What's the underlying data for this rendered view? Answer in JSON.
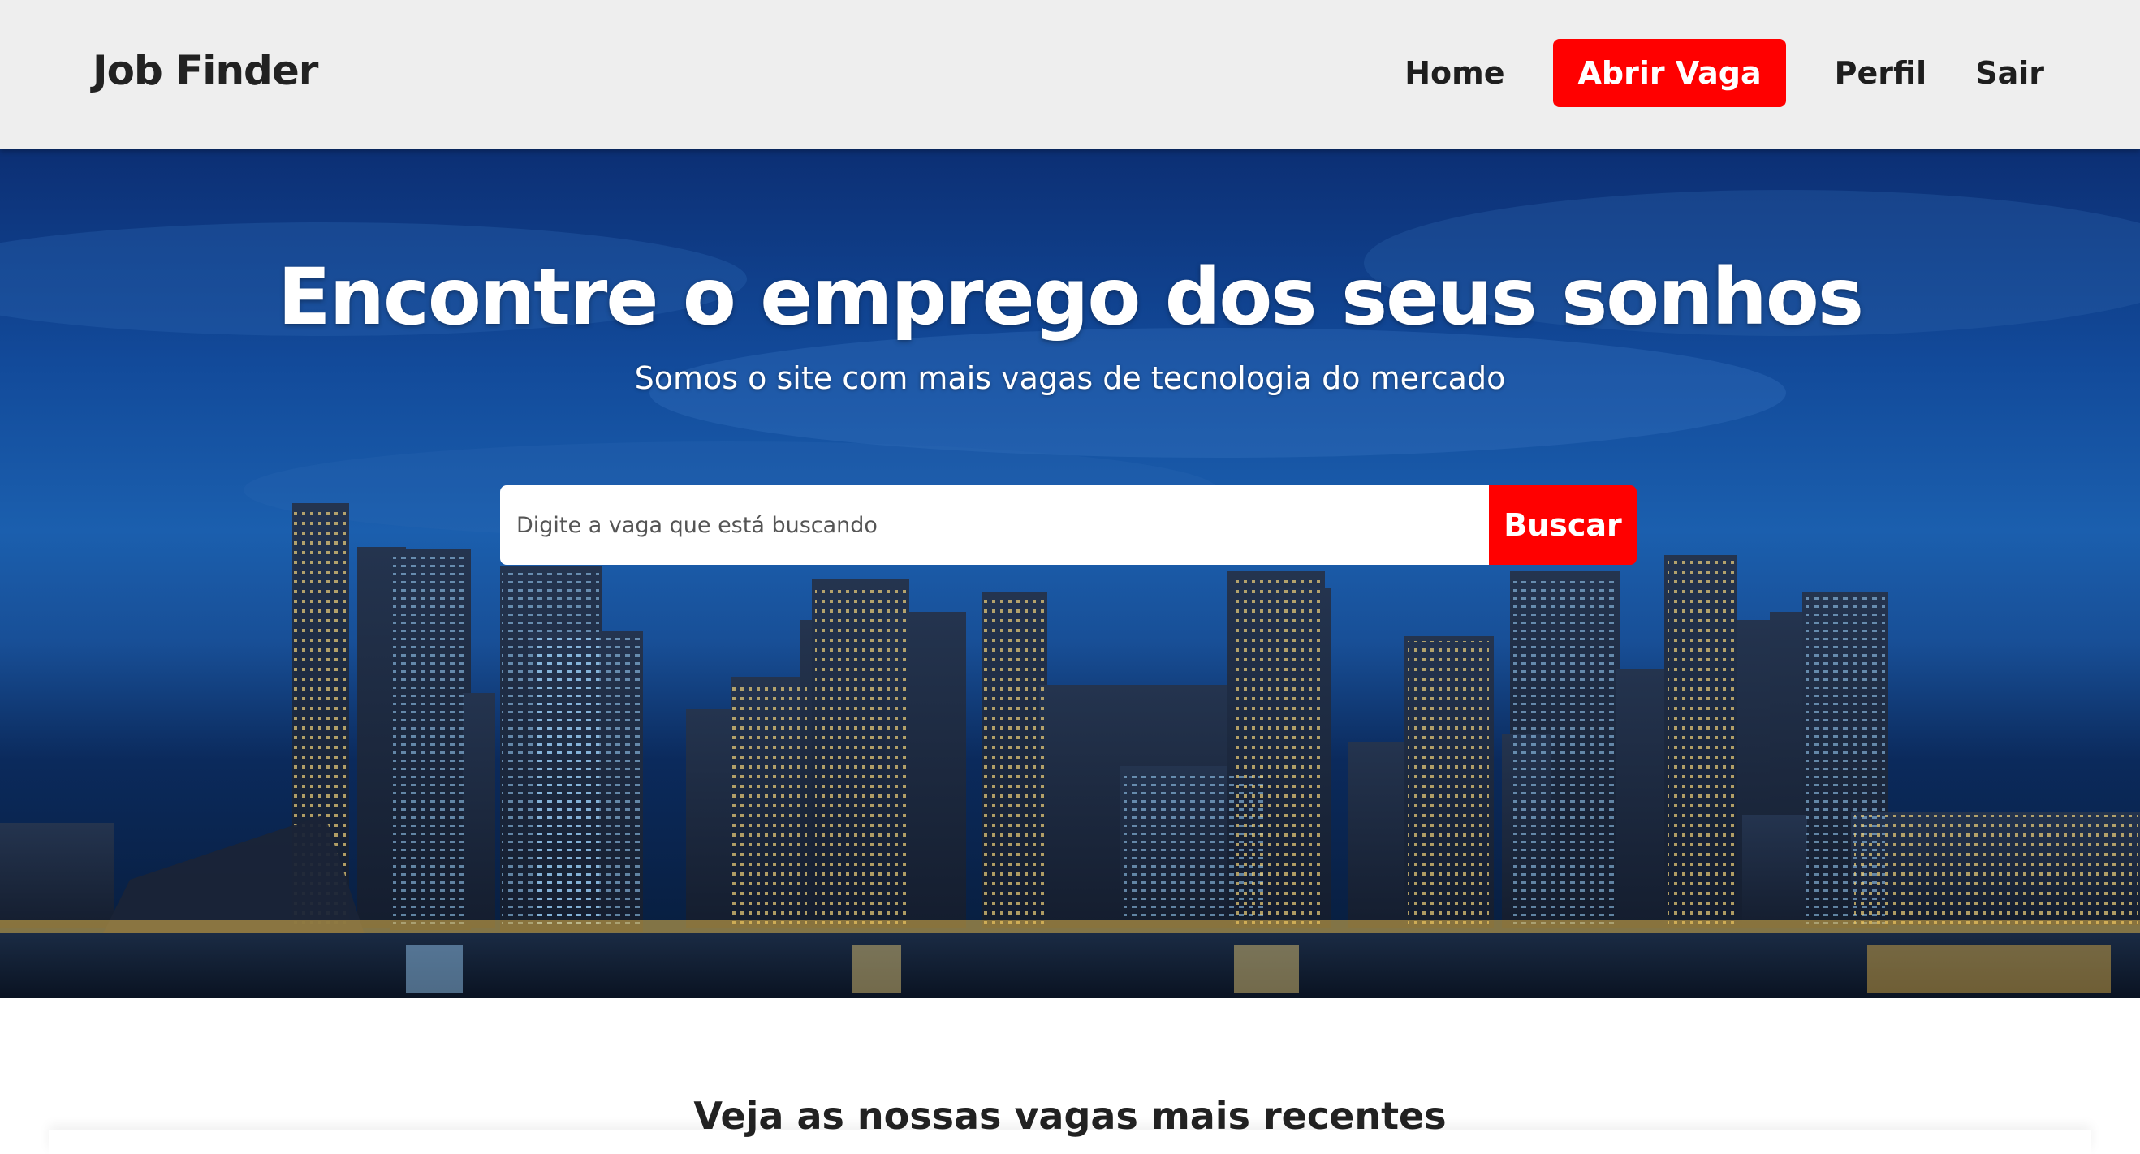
{
  "navbar": {
    "brand": "Job Finder",
    "links": [
      {
        "label": "Home"
      },
      {
        "label": "Abrir Vaga",
        "highlight": true
      },
      {
        "label": "Perfil"
      },
      {
        "label": "Sair"
      }
    ]
  },
  "hero": {
    "title": "Encontre o emprego dos seus sonhos",
    "subtitle": "Somos o site com mais vagas de tecnologia do mercado",
    "background": "city-skyline-night-photo",
    "search": {
      "placeholder": "Digite a vaga que está buscando",
      "value": "",
      "button_label": "Buscar"
    }
  },
  "recent_jobs": {
    "title": "Veja as nossas vagas mais recentes"
  },
  "colors": {
    "accent": "#ff0000",
    "navbar_bg": "#eeeeee",
    "text_dark": "#222222",
    "hero_sky": "#1b5fae"
  }
}
